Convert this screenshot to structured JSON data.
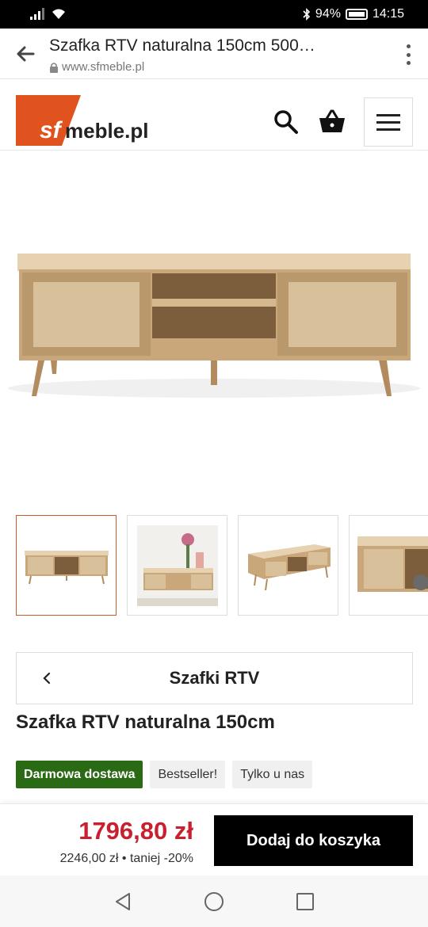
{
  "status": {
    "battery": "94%",
    "time": "14:15"
  },
  "browser": {
    "title": "Szafka RTV naturalna 150cm 500…",
    "url": "www.sfmeble.pl"
  },
  "site": {
    "logo_sf": "sf",
    "logo_rest": "meble.pl",
    "logo_mark": "®"
  },
  "product": {
    "category": "Szafki RTV",
    "title": "Szafka RTV naturalna 150cm",
    "badges": [
      "Darmowa dostawa",
      "Bestseller!",
      "Tylko u nas"
    ],
    "price": "1796,80 zł",
    "old_price": "2246,00 zł • taniej -20%",
    "add_to_cart": "Dodaj do koszyka"
  },
  "colors": {
    "brand_orange": "#e0531f",
    "price_red": "#c8202e",
    "badge_green": "#2a6a14"
  },
  "icons": [
    "back-arrow-icon",
    "lock-icon",
    "more-vert-icon",
    "search-icon",
    "basket-icon",
    "hamburger-icon",
    "chevron-left-icon",
    "nav-back-icon",
    "nav-home-icon",
    "nav-recents-icon"
  ]
}
